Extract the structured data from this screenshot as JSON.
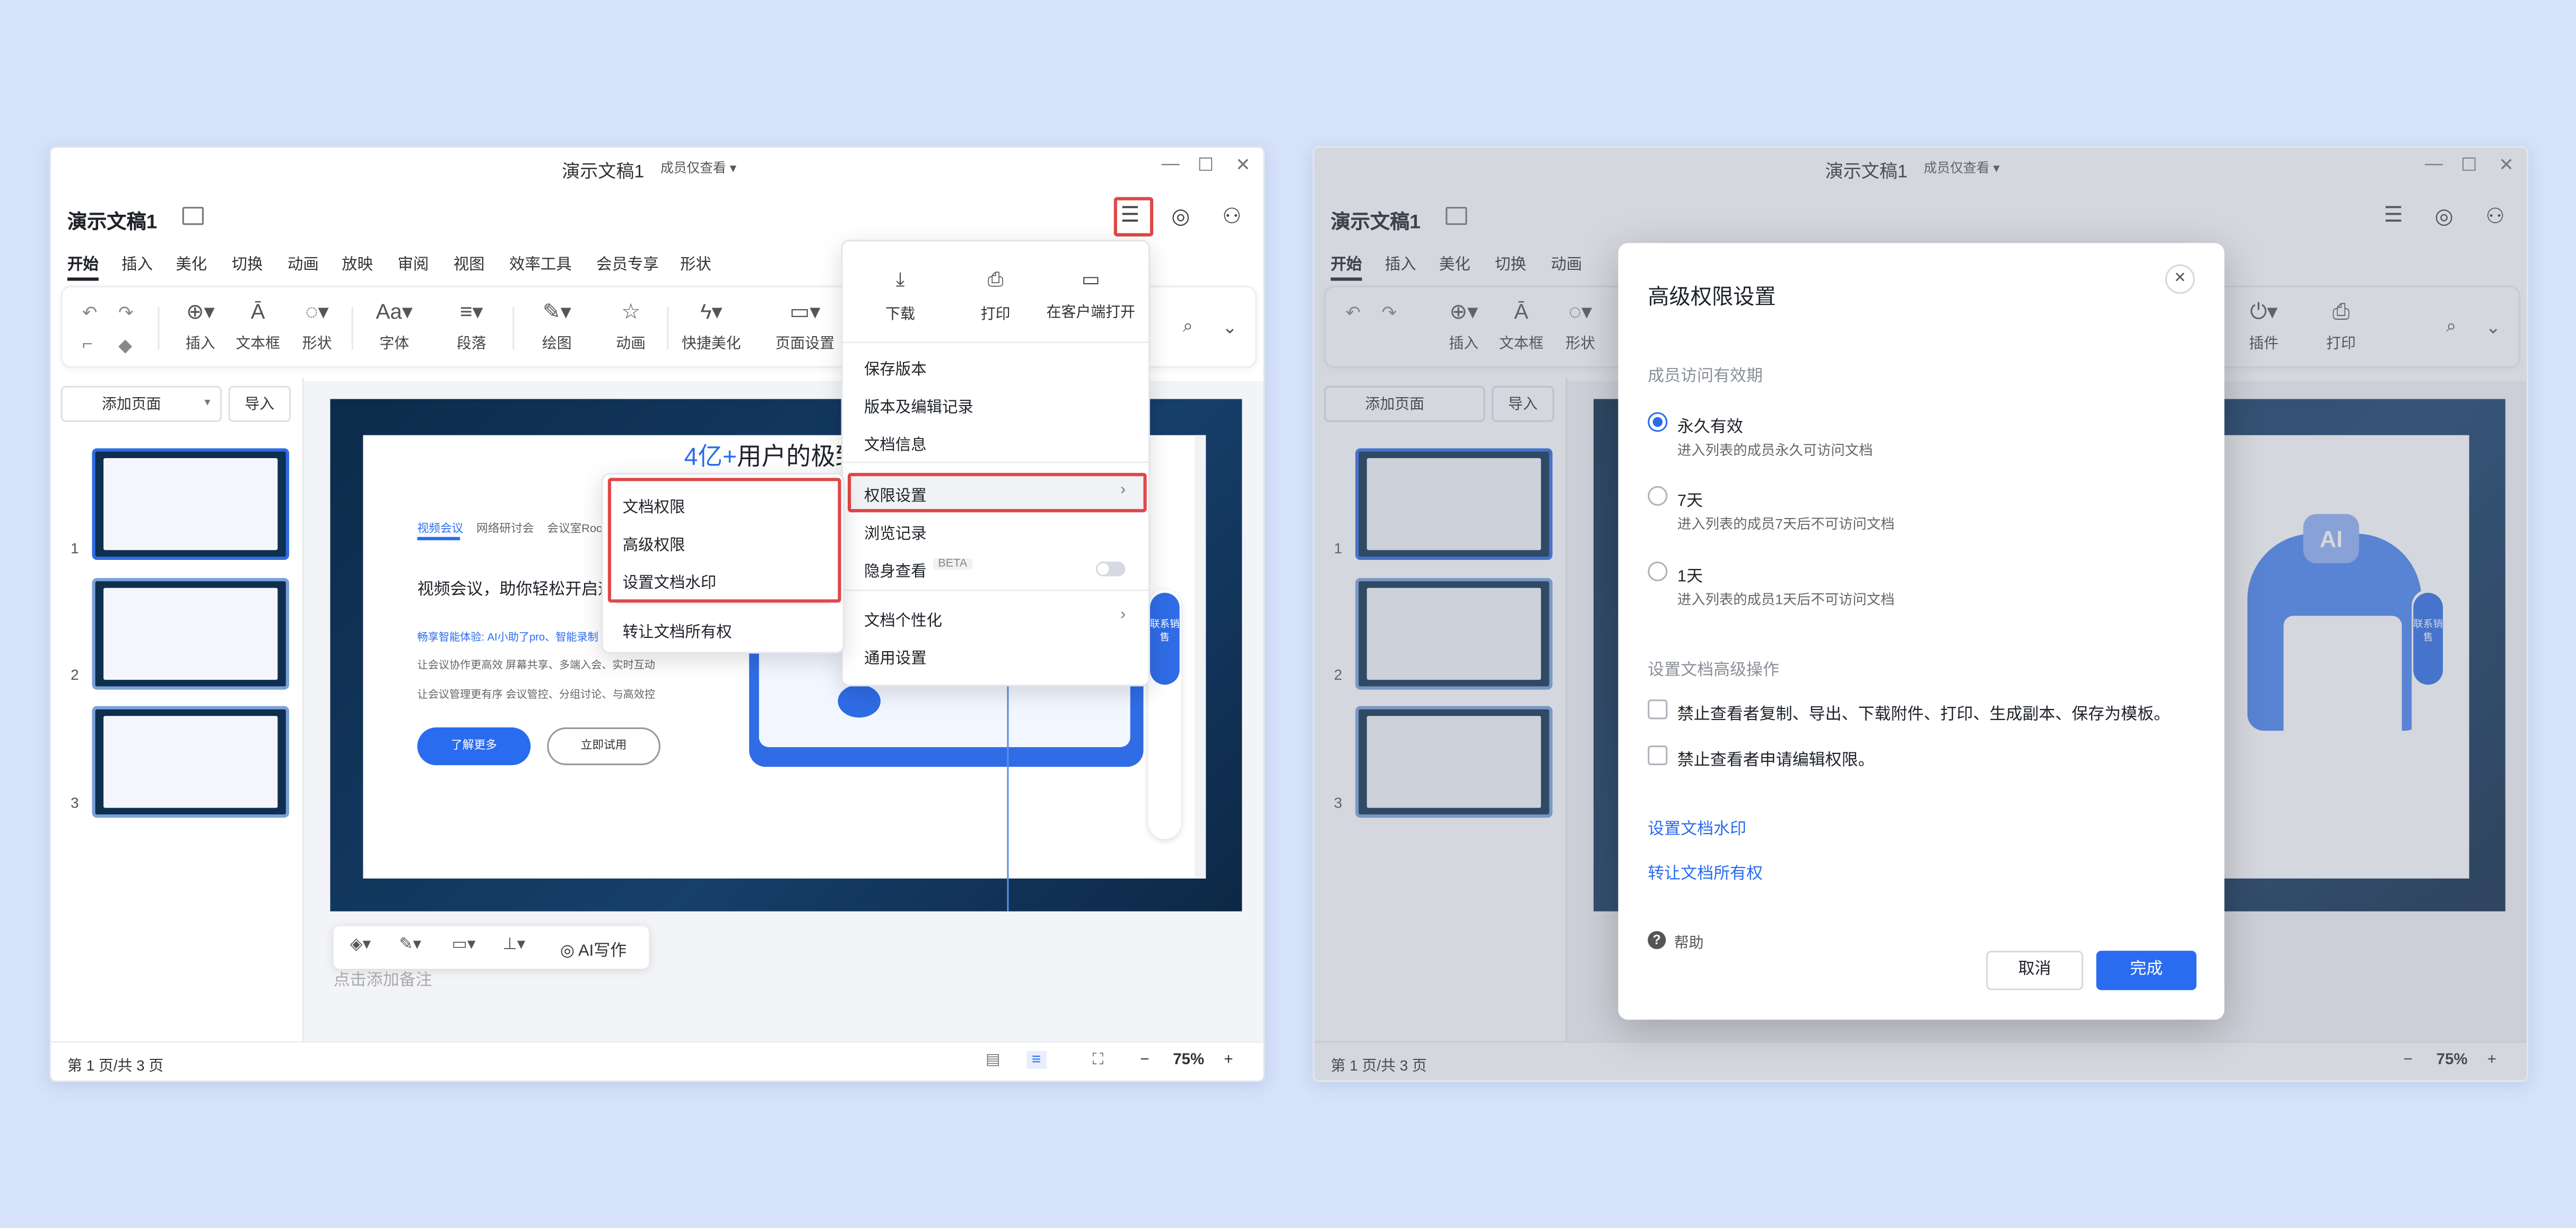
{
  "common": {
    "window_title": "演示文稿1",
    "member_view": "成员仅查看",
    "doc_title": "演示文稿1",
    "tabs": [
      "开始",
      "插入",
      "美化",
      "切换",
      "动画",
      "放映",
      "审阅",
      "视图",
      "效率工具",
      "会员专享",
      "形状"
    ],
    "add_page": "添加页面",
    "import": "导入",
    "page_status": "第 1 页/共 3 页",
    "zoom": "75%",
    "zoom_minus": "−",
    "zoom_plus": "+",
    "thumb_numbers": [
      "1",
      "2",
      "3"
    ]
  },
  "toolbar": {
    "items": [
      "插入",
      "文本框",
      "形状",
      "字体",
      "段落",
      "绘图",
      "动画",
      "快捷美化",
      "页面设置"
    ],
    "right_items": [
      "插件",
      "打印"
    ]
  },
  "slide": {
    "heading_highlight": "4亿+",
    "heading_rest": "用户的极致会",
    "nav": [
      "视频会议",
      "网络研讨会",
      "会议室Roo"
    ],
    "subheading": "视频会议，助你轻松开启远",
    "blue_line": "畅享智能体验: AI小助了pro、智能录制",
    "line1": "让会议协作更高效 屏幕共享、多端入会、实时互动",
    "line2": "让会议管理更有序 会议管控、分组讨论、与高效控",
    "btn_primary": "了解更多",
    "btn_secondary": "立即试用",
    "contact": "联系销售",
    "ai_badge": "AI",
    "add_notes": "点击添加备注",
    "float_ai": "AI写作"
  },
  "file_menu": {
    "top_actions": [
      "下载",
      "打印",
      "在客户端打开"
    ],
    "items": [
      "保存版本",
      "版本及编辑记录",
      "文档信息"
    ],
    "permission": "权限设置",
    "browse_history": "浏览记录",
    "incognito": "隐身查看",
    "beta": "BETA",
    "personalize": "文档个性化",
    "general": "通用设置"
  },
  "permission_submenu": [
    "文档权限",
    "高级权限",
    "设置文档水印",
    "转让文档所有权"
  ],
  "dialog": {
    "title": "高级权限设置",
    "section_validity": "成员访问有效期",
    "options": [
      {
        "label": "永久有效",
        "desc": "进入列表的成员永久可访问文档",
        "checked": true
      },
      {
        "label": "7天",
        "desc": "进入列表的成员7天后不可访问文档",
        "checked": false
      },
      {
        "label": "1天",
        "desc": "进入列表的成员1天后不可访问文档",
        "checked": false
      }
    ],
    "section_advanced": "设置文档高级操作",
    "checks": [
      "禁止查看者复制、导出、下载附件、打印、生成副本、保存为模板。",
      "禁止查看者申请编辑权限。"
    ],
    "link_watermark": "设置文档水印",
    "link_transfer": "转让文档所有权",
    "help": "帮助",
    "cancel": "取消",
    "done": "完成"
  },
  "colors": {
    "accent": "#2a6cf0",
    "highlight_border": "#e04848",
    "background": "#d6e2fa"
  }
}
